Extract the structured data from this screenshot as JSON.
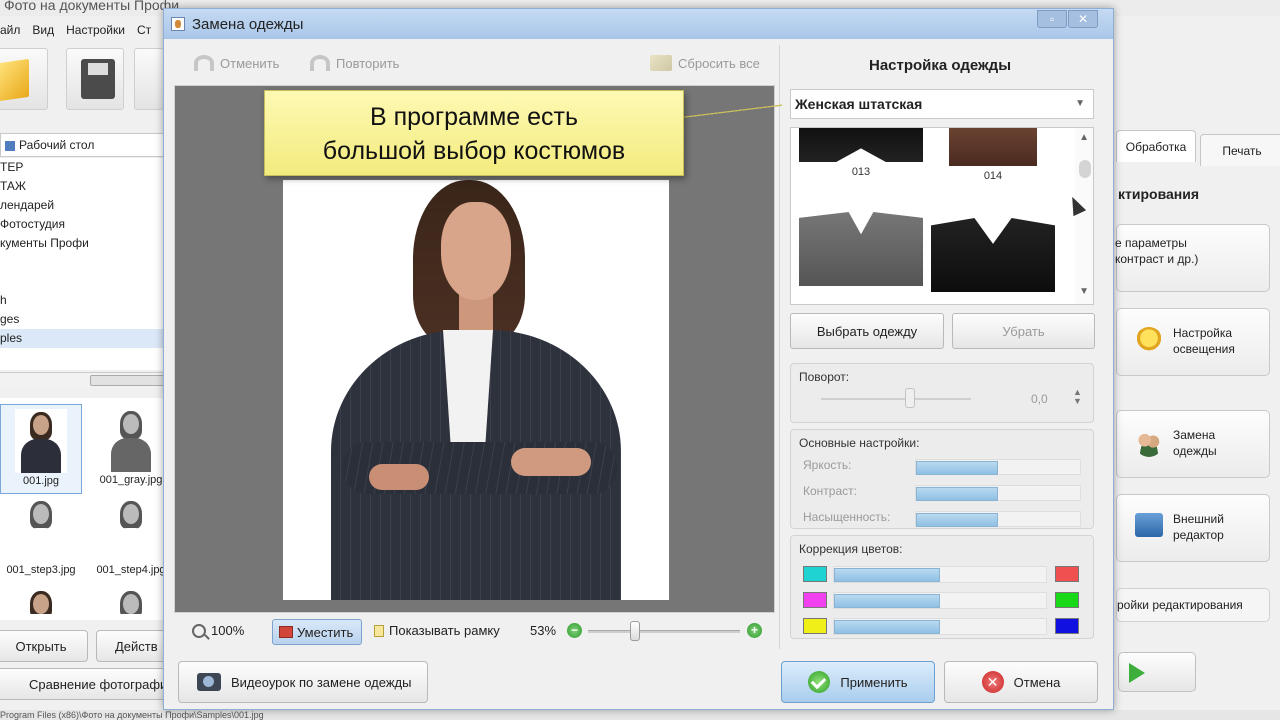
{
  "main_app": {
    "title": "Фото на документы Профи",
    "menu": [
      "айл",
      "Вид",
      "Настройки",
      "Ст"
    ],
    "path": "Рабочий стол",
    "tree": [
      "ТЕР",
      "ТАЖ",
      "лендарей",
      " Фотостудия",
      "кументы Профи",
      "",
      "",
      "h",
      "ges",
      "ples"
    ],
    "thumbnails": [
      {
        "name": "001.jpg"
      },
      {
        "name": "001_gray.jpg"
      },
      {
        "name": "001_step3.jpg"
      },
      {
        "name": "001_step4.jpg"
      }
    ],
    "open_label": "Открыть",
    "actions_label": "Действ",
    "compare_label": "Сравнение фотографи",
    "statusbar": "Program Files (x86)\\Фото на документы Профи\\Samples\\001.jpg",
    "tabs": {
      "processing": "Обработка",
      "print": "Печать"
    },
    "section_title": "ктирования",
    "cards": {
      "params": "е параметры\nконтраст и др.)",
      "lighting": "Настройка\nосвещения",
      "clothes": "Замена\nодежды",
      "editor": "Внешний\nредактор"
    },
    "edit_settings": "ройки редактирования"
  },
  "dialog": {
    "title": "Замена одежды",
    "undo_label": "Отменить",
    "redo_label": "Повторить",
    "reset_label": "Сбросить все",
    "callout": "В программе есть\nбольшой выбор костюмов",
    "zoom": {
      "actual_label": "100%",
      "fit_label": "Уместить",
      "show_frame_label": "Показывать рамку",
      "percent": "53%",
      "minus": "−",
      "plus": "+"
    },
    "video_label": "Видеоурок по замене одежды",
    "settings": {
      "title": "Настройка одежды",
      "style_value": "Женская штатская",
      "clothes": [
        {
          "label": "013"
        },
        {
          "label": "014"
        },
        {
          "label": ""
        },
        {
          "label": ""
        }
      ],
      "choose_label": "Выбрать одежду",
      "remove_label": "Убрать",
      "rotation_title": "Поворот:",
      "rotation_value": "0,0",
      "basic_title": "Основные настройки:",
      "brightness_label": "Яркость:",
      "contrast_label": "Контраст:",
      "saturation_label": "Насыщенность:",
      "brightness_level": 0.5,
      "contrast_level": 0.5,
      "saturation_level": 0.5,
      "color_title": "Коррекция цветов:",
      "color_rows": [
        {
          "left": "#1fd3d3",
          "right": "#f05050",
          "level": 0.5
        },
        {
          "left": "#f040f0",
          "right": "#18d818",
          "level": 0.5
        },
        {
          "left": "#f0f018",
          "right": "#1010e0",
          "level": 0.5
        }
      ]
    },
    "apply_label": "Применить",
    "cancel_label": "Отмена"
  }
}
